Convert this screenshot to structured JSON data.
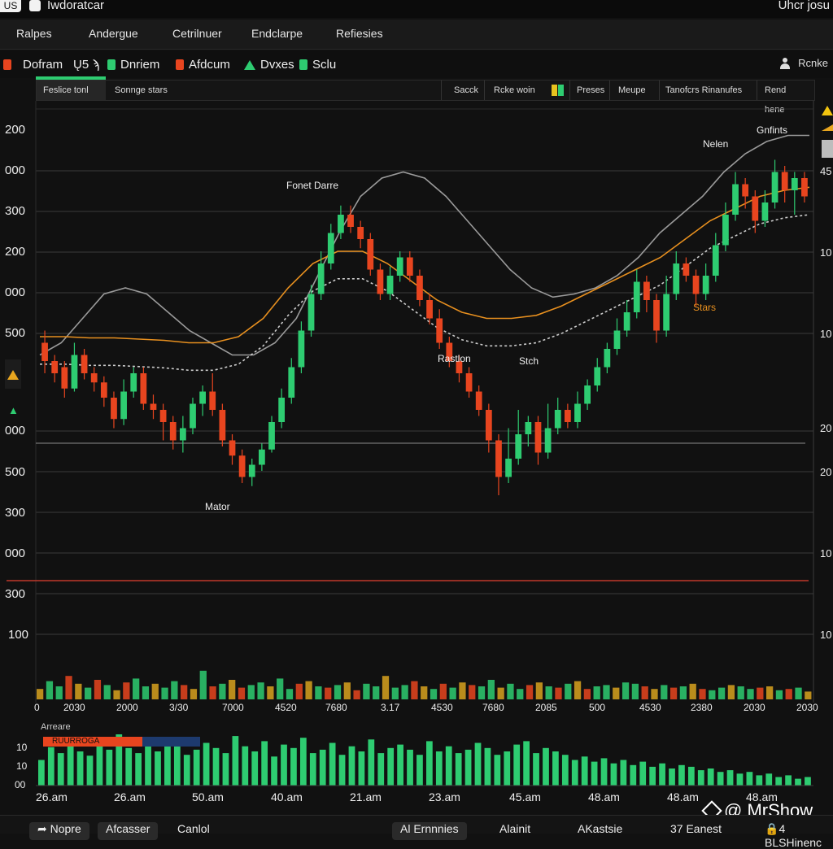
{
  "titlebar": {
    "badge": "US",
    "title": "Iwdoratcar",
    "user": "Uhcr josu"
  },
  "menu": [
    "Ralpes",
    "Andergue",
    "Cetrilnuer",
    "Endclarpe",
    "Refiesies"
  ],
  "legend": {
    "items": [
      {
        "label": "Dofram",
        "marker": "square",
        "color": "#e8451f"
      },
      {
        "label": "Ų5 ϡ",
        "marker": "none",
        "color": "#eeeeee"
      },
      {
        "label": "Dnriem",
        "marker": "square",
        "color": "#2ecc71"
      },
      {
        "label": "Afdcum",
        "marker": "square",
        "color": "#e8451f"
      },
      {
        "label": "Dvxes",
        "marker": "triangle",
        "color": "#2ecc71"
      },
      {
        "label": "Sclu",
        "marker": "square",
        "color": "#2ecc71"
      }
    ],
    "right_label": "Rcnke"
  },
  "tabs": {
    "left": [
      "Feslice tonl",
      "Sonnge stars"
    ],
    "right": [
      "Sacck",
      "Rcke woin",
      "Preses",
      "Meupe",
      "Tanofcrs Rinanufes",
      "Rend hene"
    ]
  },
  "chart_data": {
    "type": "candlestick",
    "y_tick_labels_left": [
      "200",
      "000",
      "300",
      "200",
      "000",
      "500",
      "000",
      "500",
      "300",
      "000",
      "300",
      "100"
    ],
    "y_tick_labels_right": [
      "45",
      "10",
      "10",
      "20",
      "20",
      "10",
      "10"
    ],
    "x_tick_labels": [
      "0",
      "2030",
      "2000",
      "3/30",
      "7000",
      "4520",
      "7680",
      "3.17",
      "4530",
      "7680",
      "2085",
      "500",
      "4530",
      "2380",
      "2030",
      "2030"
    ],
    "annotations": [
      "Fonet Darre",
      "Rastlon",
      "Stch",
      "Mator",
      "Nelen",
      "Gnfints",
      "Stars"
    ],
    "candles": [
      {
        "o": 520,
        "c": 490,
        "h": 540,
        "l": 470
      },
      {
        "o": 490,
        "c": 470,
        "h": 500,
        "l": 455
      },
      {
        "o": 480,
        "c": 445,
        "h": 490,
        "l": 430
      },
      {
        "o": 445,
        "c": 500,
        "h": 520,
        "l": 440
      },
      {
        "o": 500,
        "c": 470,
        "h": 510,
        "l": 460
      },
      {
        "o": 470,
        "c": 455,
        "h": 480,
        "l": 440
      },
      {
        "o": 455,
        "c": 430,
        "h": 465,
        "l": 415
      },
      {
        "o": 430,
        "c": 395,
        "h": 440,
        "l": 380
      },
      {
        "o": 395,
        "c": 440,
        "h": 460,
        "l": 385
      },
      {
        "o": 440,
        "c": 470,
        "h": 480,
        "l": 430
      },
      {
        "o": 470,
        "c": 420,
        "h": 480,
        "l": 410
      },
      {
        "o": 420,
        "c": 410,
        "h": 435,
        "l": 395
      },
      {
        "o": 410,
        "c": 390,
        "h": 420,
        "l": 360
      },
      {
        "o": 390,
        "c": 360,
        "h": 400,
        "l": 345
      },
      {
        "o": 360,
        "c": 380,
        "h": 400,
        "l": 340
      },
      {
        "o": 380,
        "c": 420,
        "h": 430,
        "l": 370
      },
      {
        "o": 420,
        "c": 440,
        "h": 450,
        "l": 400
      },
      {
        "o": 440,
        "c": 410,
        "h": 470,
        "l": 400
      },
      {
        "o": 410,
        "c": 360,
        "h": 420,
        "l": 350
      },
      {
        "o": 360,
        "c": 335,
        "h": 370,
        "l": 320
      },
      {
        "o": 335,
        "c": 300,
        "h": 345,
        "l": 290
      },
      {
        "o": 300,
        "c": 320,
        "h": 330,
        "l": 285
      },
      {
        "o": 320,
        "c": 345,
        "h": 355,
        "l": 310
      },
      {
        "o": 345,
        "c": 390,
        "h": 400,
        "l": 340
      },
      {
        "o": 390,
        "c": 430,
        "h": 445,
        "l": 380
      },
      {
        "o": 430,
        "c": 480,
        "h": 495,
        "l": 420
      },
      {
        "o": 480,
        "c": 540,
        "h": 555,
        "l": 470
      },
      {
        "o": 540,
        "c": 600,
        "h": 615,
        "l": 530
      },
      {
        "o": 600,
        "c": 650,
        "h": 670,
        "l": 590
      },
      {
        "o": 650,
        "c": 700,
        "h": 715,
        "l": 640
      },
      {
        "o": 700,
        "c": 730,
        "h": 745,
        "l": 690
      },
      {
        "o": 730,
        "c": 710,
        "h": 745,
        "l": 700
      },
      {
        "o": 710,
        "c": 690,
        "h": 720,
        "l": 675
      },
      {
        "o": 690,
        "c": 640,
        "h": 700,
        "l": 630
      },
      {
        "o": 640,
        "c": 600,
        "h": 650,
        "l": 590
      },
      {
        "o": 600,
        "c": 630,
        "h": 645,
        "l": 590
      },
      {
        "o": 630,
        "c": 660,
        "h": 670,
        "l": 620
      },
      {
        "o": 660,
        "c": 630,
        "h": 670,
        "l": 620
      },
      {
        "o": 630,
        "c": 590,
        "h": 640,
        "l": 580
      },
      {
        "o": 590,
        "c": 560,
        "h": 600,
        "l": 550
      },
      {
        "o": 560,
        "c": 520,
        "h": 575,
        "l": 510
      },
      {
        "o": 520,
        "c": 490,
        "h": 530,
        "l": 480
      },
      {
        "o": 490,
        "c": 470,
        "h": 500,
        "l": 455
      },
      {
        "o": 470,
        "c": 440,
        "h": 480,
        "l": 430
      },
      {
        "o": 440,
        "c": 410,
        "h": 450,
        "l": 400
      },
      {
        "o": 410,
        "c": 360,
        "h": 420,
        "l": 340
      },
      {
        "o": 360,
        "c": 300,
        "h": 370,
        "l": 270
      },
      {
        "o": 300,
        "c": 330,
        "h": 380,
        "l": 290
      },
      {
        "o": 330,
        "c": 370,
        "h": 410,
        "l": 320
      },
      {
        "o": 370,
        "c": 390,
        "h": 400,
        "l": 350
      },
      {
        "o": 390,
        "c": 340,
        "h": 400,
        "l": 320
      },
      {
        "o": 340,
        "c": 380,
        "h": 420,
        "l": 330
      },
      {
        "o": 380,
        "c": 410,
        "h": 430,
        "l": 370
      },
      {
        "o": 410,
        "c": 390,
        "h": 420,
        "l": 380
      },
      {
        "o": 390,
        "c": 420,
        "h": 440,
        "l": 380
      },
      {
        "o": 420,
        "c": 450,
        "h": 460,
        "l": 410
      },
      {
        "o": 450,
        "c": 480,
        "h": 495,
        "l": 440
      },
      {
        "o": 480,
        "c": 510,
        "h": 520,
        "l": 470
      },
      {
        "o": 510,
        "c": 540,
        "h": 560,
        "l": 500
      },
      {
        "o": 540,
        "c": 570,
        "h": 590,
        "l": 530
      },
      {
        "o": 570,
        "c": 620,
        "h": 640,
        "l": 560
      },
      {
        "o": 620,
        "c": 590,
        "h": 630,
        "l": 570
      },
      {
        "o": 590,
        "c": 540,
        "h": 600,
        "l": 520
      },
      {
        "o": 540,
        "c": 600,
        "h": 630,
        "l": 530
      },
      {
        "o": 600,
        "c": 650,
        "h": 670,
        "l": 590
      },
      {
        "o": 650,
        "c": 630,
        "h": 660,
        "l": 620
      },
      {
        "o": 630,
        "c": 600,
        "h": 640,
        "l": 580
      },
      {
        "o": 600,
        "c": 630,
        "h": 650,
        "l": 590
      },
      {
        "o": 630,
        "c": 680,
        "h": 700,
        "l": 620
      },
      {
        "o": 680,
        "c": 730,
        "h": 750,
        "l": 670
      },
      {
        "o": 730,
        "c": 780,
        "h": 800,
        "l": 720
      },
      {
        "o": 780,
        "c": 760,
        "h": 790,
        "l": 740
      },
      {
        "o": 760,
        "c": 720,
        "h": 770,
        "l": 700
      },
      {
        "o": 720,
        "c": 750,
        "h": 770,
        "l": 710
      },
      {
        "o": 750,
        "c": 800,
        "h": 820,
        "l": 740
      },
      {
        "o": 800,
        "c": 770,
        "h": 810,
        "l": 750
      },
      {
        "o": 770,
        "c": 790,
        "h": 800,
        "l": 730
      },
      {
        "o": 790,
        "c": 760,
        "h": 800,
        "l": 750
      }
    ],
    "ma_grey": [
      500,
      520,
      560,
      600,
      610,
      600,
      570,
      540,
      520,
      500,
      500,
      520,
      560,
      630,
      700,
      760,
      790,
      800,
      790,
      760,
      720,
      680,
      640,
      610,
      595,
      600,
      610,
      630,
      660,
      700,
      730,
      760,
      800,
      830,
      850,
      860,
      860
    ],
    "ma_orange": [
      530,
      530,
      528,
      528,
      526,
      524,
      520,
      520,
      530,
      560,
      610,
      650,
      670,
      670,
      650,
      620,
      590,
      570,
      560,
      560,
      565,
      580,
      600,
      620,
      640,
      660,
      690,
      720,
      740,
      760,
      770,
      775
    ],
    "volume": [
      8,
      14,
      10,
      18,
      12,
      9,
      15,
      11,
      7,
      13,
      16,
      10,
      12,
      9,
      14,
      11,
      8,
      22,
      10,
      12,
      15,
      9,
      11,
      13,
      10,
      16,
      8,
      12,
      14,
      10,
      9,
      11,
      13,
      7,
      12,
      10,
      18,
      9,
      11,
      14,
      10,
      8,
      12,
      9,
      13,
      11,
      10,
      15,
      9,
      12,
      8,
      11,
      13,
      10,
      9,
      12,
      14,
      8,
      10,
      11,
      9,
      13,
      12,
      10,
      8,
      11,
      9,
      10,
      12,
      8,
      7,
      9,
      11,
      10,
      8,
      9,
      10,
      7,
      8,
      9,
      6
    ],
    "oscillator": [
      30,
      45,
      38,
      55,
      40,
      35,
      50,
      42,
      60,
      44,
      38,
      52,
      40,
      48,
      55,
      36,
      42,
      50,
      44,
      38,
      58,
      46,
      40,
      52,
      34,
      48,
      44,
      56,
      38,
      42,
      50,
      36,
      46,
      40,
      54,
      38,
      44,
      48,
      42,
      36,
      52,
      40,
      46,
      38,
      42,
      50,
      44,
      36,
      40,
      48,
      52,
      38,
      44,
      40,
      36,
      30,
      34,
      28,
      32,
      26,
      30,
      24,
      28,
      22,
      26,
      20,
      24,
      22,
      18,
      20,
      16,
      18,
      14,
      16,
      12,
      14,
      10,
      12,
      8,
      10
    ]
  },
  "lower_panel": {
    "title": "Arreare",
    "alert_label": "RUURROGA",
    "y_tick_labels": [
      "10",
      "10",
      "00"
    ],
    "x_tick_labels": [
      "26.am",
      "26.am",
      "50.am",
      "40.am",
      "21.am",
      "23.am",
      "45.am",
      "48.am",
      "48.am",
      "48.am"
    ]
  },
  "bottombar": [
    "Nopre",
    "Afcasser",
    "Canlol",
    "Al Ernnnies",
    "Alainit",
    "AKastsie",
    "37 Eanest",
    "4 BLSHinenc"
  ],
  "watermark": "@ MrShow",
  "colors": {
    "up": "#2ecc71",
    "down": "#e8451f",
    "ma_orange": "#e8901f",
    "ma_grey": "#9a9a9a",
    "support": "#c0392b",
    "bg": "#111111"
  }
}
